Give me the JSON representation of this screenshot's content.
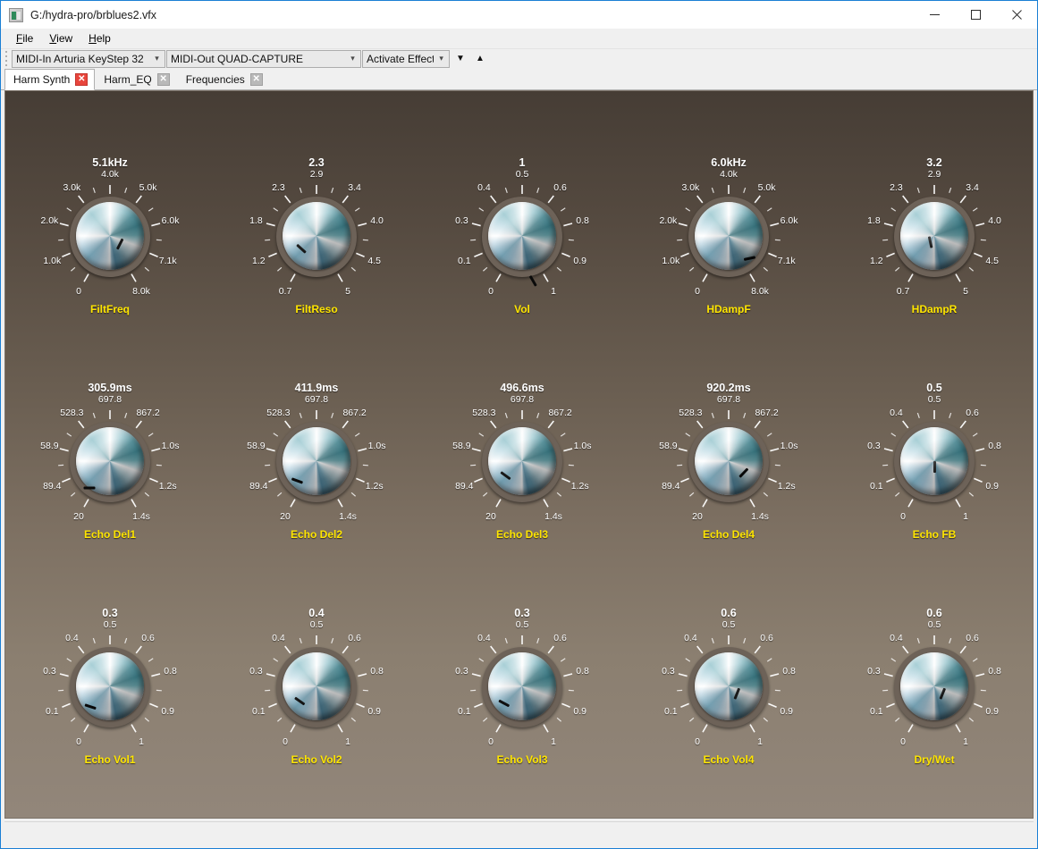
{
  "window": {
    "title": "G:/hydra-pro/brblues2.vfx",
    "icon": "app-icon",
    "minimize_label": "—",
    "maximize_label": "☐",
    "close_label": "✕"
  },
  "menubar": {
    "items": [
      {
        "label": "File",
        "accel": "F"
      },
      {
        "label": "View",
        "accel": "V"
      },
      {
        "label": "Help",
        "accel": "H"
      }
    ]
  },
  "toolbar": {
    "midi_in": {
      "value": "MIDI-In Arturia KeyStep 32"
    },
    "midi_out": {
      "value": "MIDI-Out QUAD-CAPTURE"
    },
    "activate": {
      "value": "Activate Effect"
    },
    "down_arrow": "▼",
    "up_arrow": "▲"
  },
  "tabs": [
    {
      "label": "Harm Synth",
      "active": true,
      "close": "✕"
    },
    {
      "label": "Harm_EQ",
      "active": false,
      "close": "✕"
    },
    {
      "label": "Frequencies",
      "active": false,
      "close": "✕"
    }
  ],
  "colors": {
    "label_yellow": "#ffe600",
    "value_white": "#ffffff",
    "panel_top": "#463d35",
    "panel_bottom": "#92867a",
    "accent_blue": "#1a7fd4",
    "tab_close_active": "#e8453c"
  },
  "knobs": [
    {
      "name": "FiltFreq",
      "value": "5.1kHz",
      "angle": 27,
      "ticks": [
        "0",
        "1.0k",
        "2.0k",
        "3.0k",
        "4.0k",
        "5.0k",
        "6.0k",
        "7.1k",
        "8.0k"
      ]
    },
    {
      "name": "FiltReso",
      "value": "2.3",
      "angle": -48,
      "ticks": [
        "0.7",
        "1.2",
        "1.8",
        "2.3",
        "2.9",
        "3.4",
        "4.0",
        "4.5",
        "5"
      ]
    },
    {
      "name": "Vol",
      "value": "1",
      "angle": 150,
      "ticks": [
        "0",
        "0.1",
        "0.3",
        "0.4",
        "0.5",
        "0.6",
        "0.8",
        "0.9",
        "1"
      ]
    },
    {
      "name": "HDampF",
      "value": "6.0kHz",
      "angle": 78,
      "ticks": [
        "0",
        "1.0k",
        "2.0k",
        "3.0k",
        "4.0k",
        "5.0k",
        "6.0k",
        "7.1k",
        "8.0k"
      ]
    },
    {
      "name": "HDampR",
      "value": "3.2",
      "angle": -12,
      "ticks": [
        "0.7",
        "1.2",
        "1.8",
        "2.3",
        "2.9",
        "3.4",
        "4.0",
        "4.5",
        "5"
      ]
    },
    {
      "name": "Echo Del1",
      "value": "305.9ms",
      "angle": -90,
      "ticks": [
        "20",
        "89.4",
        "58.9",
        "528.3",
        "697.8",
        "867.2",
        "1.0s",
        "1.2s",
        "1.4s"
      ]
    },
    {
      "name": "Echo Del2",
      "value": "411.9ms",
      "angle": -70,
      "ticks": [
        "20",
        "89.4",
        "58.9",
        "528.3",
        "697.8",
        "867.2",
        "1.0s",
        "1.2s",
        "1.4s"
      ]
    },
    {
      "name": "Echo Del3",
      "value": "496.6ms",
      "angle": -54,
      "ticks": [
        "20",
        "89.4",
        "58.9",
        "528.3",
        "697.8",
        "867.2",
        "1.0s",
        "1.2s",
        "1.4s"
      ]
    },
    {
      "name": "Echo Del4",
      "value": "920.2ms",
      "angle": 44,
      "ticks": [
        "20",
        "89.4",
        "58.9",
        "528.3",
        "697.8",
        "867.2",
        "1.0s",
        "1.2s",
        "1.4s"
      ]
    },
    {
      "name": "Echo FB",
      "value": "0.5",
      "angle": 0,
      "ticks": [
        "0",
        "0.1",
        "0.3",
        "0.4",
        "0.5",
        "0.6",
        "0.8",
        "0.9",
        "1"
      ]
    },
    {
      "name": "Echo Vol1",
      "value": "0.3",
      "angle": -72,
      "ticks": [
        "0",
        "0.1",
        "0.3",
        "0.4",
        "0.5",
        "0.6",
        "0.8",
        "0.9",
        "1"
      ]
    },
    {
      "name": "Echo Vol2",
      "value": "0.4",
      "angle": -55,
      "ticks": [
        "0",
        "0.1",
        "0.3",
        "0.4",
        "0.5",
        "0.6",
        "0.8",
        "0.9",
        "1"
      ]
    },
    {
      "name": "Echo Vol3",
      "value": "0.3",
      "angle": -62,
      "ticks": [
        "0",
        "0.1",
        "0.3",
        "0.4",
        "0.5",
        "0.6",
        "0.8",
        "0.9",
        "1"
      ]
    },
    {
      "name": "Echo Vol4",
      "value": "0.6",
      "angle": 22,
      "ticks": [
        "0",
        "0.1",
        "0.3",
        "0.4",
        "0.5",
        "0.6",
        "0.8",
        "0.9",
        "1"
      ]
    },
    {
      "name": "Dry/Wet",
      "value": "0.6",
      "angle": 22,
      "ticks": [
        "0",
        "0.1",
        "0.3",
        "0.4",
        "0.5",
        "0.6",
        "0.8",
        "0.9",
        "1"
      ]
    }
  ]
}
